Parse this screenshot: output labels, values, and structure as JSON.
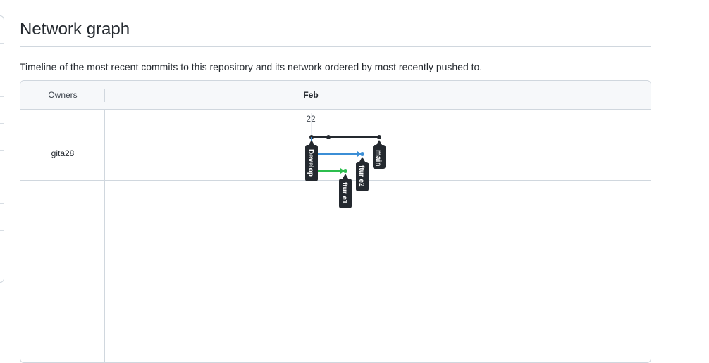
{
  "page": {
    "title": "Network graph",
    "description": "Timeline of the most recent commits to this repository and its network ordered by most recently pushed to."
  },
  "network": {
    "owners_label": "Owners",
    "month_label": "Feb",
    "day_label": "22",
    "owner": "gita28",
    "branches": [
      {
        "name": "main",
        "color": "#24292f"
      },
      {
        "name": "Develop",
        "color": "#24292f"
      },
      {
        "name": "ftur e2",
        "color": "#3b8ed6"
      },
      {
        "name": "ftur e1",
        "color": "#2cbe4e"
      }
    ]
  }
}
